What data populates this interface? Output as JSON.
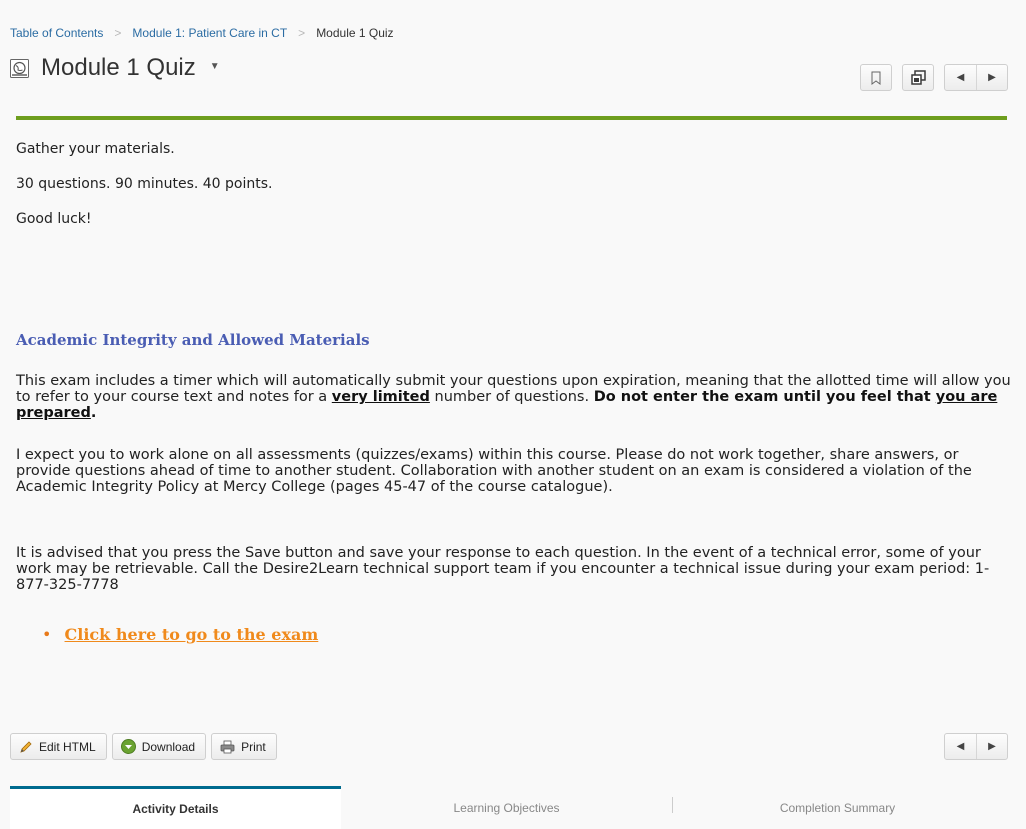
{
  "breadcrumb": {
    "items": [
      "Table of Contents",
      "Module 1: Patient Care in CT"
    ],
    "current": "Module 1 Quiz",
    "separator": ">"
  },
  "header": {
    "title": "Module 1 Quiz",
    "icon": "globe-page-icon",
    "caret": "▼",
    "buttons": [
      "bookmark-icon",
      "new-window-icon",
      "previous-icon",
      "next-icon"
    ]
  },
  "content": {
    "lines": [
      "Gather your materials.",
      "30 questions.  90 minutes.  40 points.",
      "Good luck!"
    ],
    "section_heading": "Academic Integrity and Allowed Materials",
    "para1": {
      "t1": "This exam includes a timer which will automatically submit your questions upon expiration, meaning that the allotted time will allow you to refer to your course text and notes for a ",
      "t2": "very limited",
      "t3": " number of questions. ",
      "t4": "Do not enter the exam until you feel that ",
      "t5": "you are prepared",
      "t6": "."
    },
    "para2": "I expect you to work alone on all assessments (quizzes/exams) within this course. Please do not work together, share answers, or provide questions ahead of time to another student. Collaboration with another student on an exam is considered a violation of the Academic Integrity Policy at Mercy College (pages 45-47 of the course catalogue).",
    "para3": "It is advised that you press the Save button and save your response to each question. In the event of a technical error, some of your work may be retrievable. Call the Desire2Learn technical support team if you encounter a technical issue during your exam period:  1-877-325-7778",
    "exam_link": "Click here to go to the exam "
  },
  "toolbar": {
    "edit_label": "Edit HTML",
    "download_label": "Download",
    "print_label": "Print"
  },
  "tabs": [
    "Activity Details",
    "Learning Objectives",
    "Completion Summary"
  ],
  "colors": {
    "accent_green": "#6e9e1e",
    "link_blue": "#2b6ca3",
    "heading_blue": "#4a5db3",
    "link_orange": "#f08a1c",
    "tab_active": "#006b8f"
  }
}
